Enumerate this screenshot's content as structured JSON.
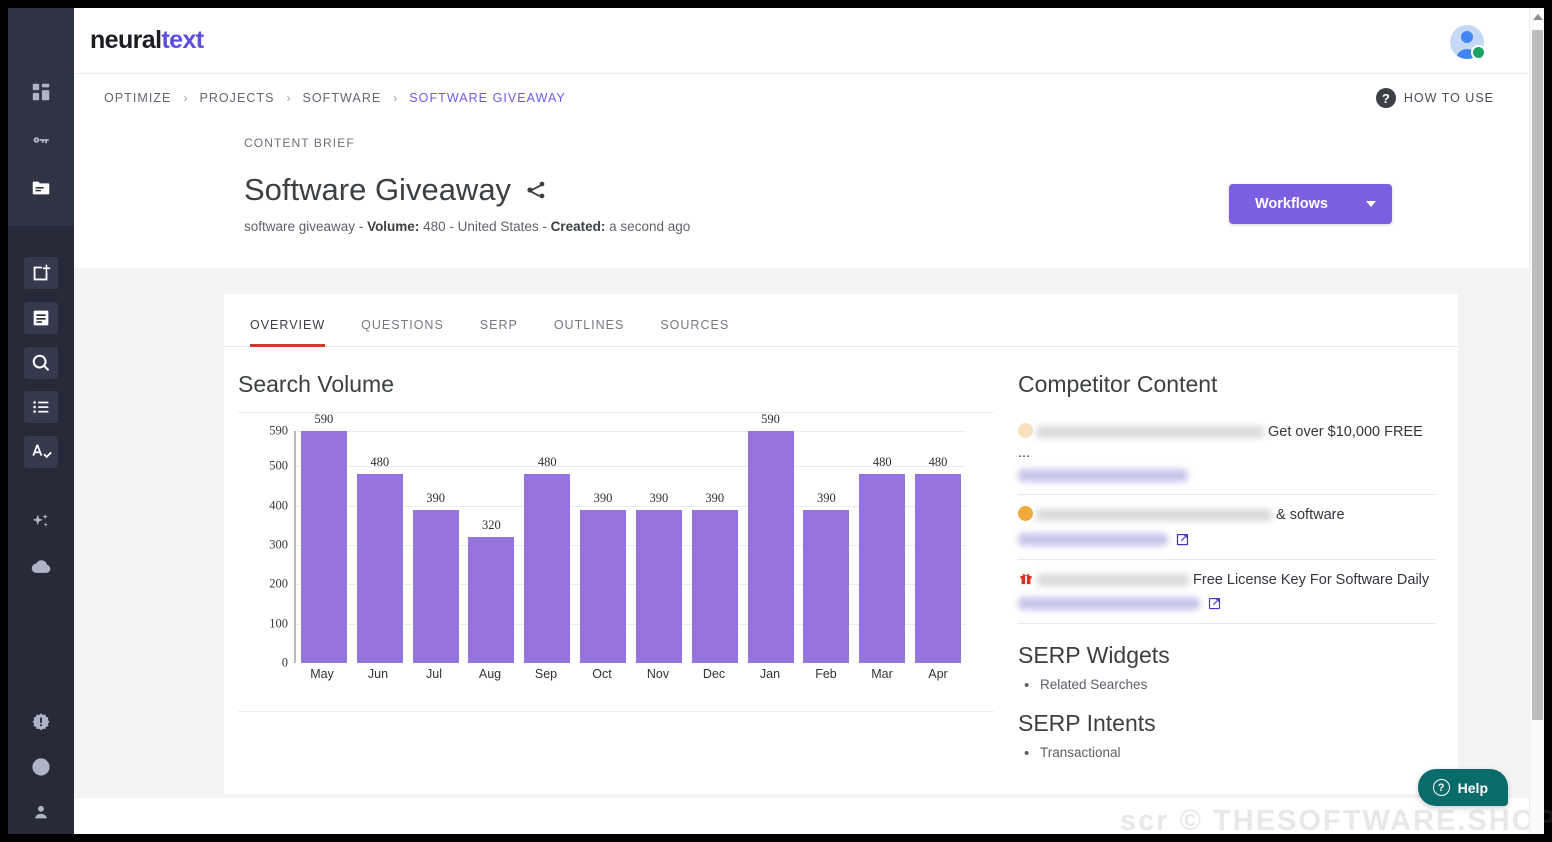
{
  "app": {
    "logo_part1": "neural",
    "logo_part2": "text"
  },
  "topbar": {
    "avatar_name": "user-avatar",
    "status": "online"
  },
  "breadcrumb": {
    "items": [
      {
        "label": "OPTIMIZE",
        "active": false
      },
      {
        "label": "PROJECTS",
        "active": false
      },
      {
        "label": "SOFTWARE",
        "active": false
      },
      {
        "label": "SOFTWARE GIVEAWAY",
        "active": true
      }
    ],
    "separator": "›"
  },
  "how_to_use": {
    "badge": "?",
    "label": "HOW TO USE"
  },
  "title_block": {
    "eyebrow": "CONTENT BRIEF",
    "title": "Software Giveaway",
    "keyword": "software giveaway",
    "sep1": " - ",
    "volume_label": "Volume:",
    "volume_value": " 480",
    "sep2": " - ",
    "country": "United States",
    "sep3": " - ",
    "created_label": "Created:",
    "created_value": " a second ago"
  },
  "workflows_button": {
    "label": "Workflows"
  },
  "tabs": [
    {
      "label": "OVERVIEW",
      "active": true
    },
    {
      "label": "QUESTIONS",
      "active": false
    },
    {
      "label": "SERP",
      "active": false
    },
    {
      "label": "OUTLINES",
      "active": false
    },
    {
      "label": "SOURCES",
      "active": false
    }
  ],
  "search_volume": {
    "heading": "Search Volume"
  },
  "chart_data": {
    "type": "bar",
    "title": "Search Volume",
    "xlabel": "",
    "ylabel": "",
    "categories": [
      "May",
      "Jun",
      "Jul",
      "Aug",
      "Sep",
      "Oct",
      "Nov",
      "Dec",
      "Jan",
      "Feb",
      "Mar",
      "Apr"
    ],
    "values": [
      590,
      480,
      390,
      320,
      480,
      390,
      390,
      390,
      590,
      390,
      480,
      480
    ],
    "yticks": [
      0,
      100,
      200,
      300,
      400,
      500,
      590
    ],
    "ylim": [
      0,
      590
    ],
    "grid": true,
    "legend": false,
    "bar_color": "#9575dd",
    "show_value_labels": true
  },
  "competitor": {
    "heading": "Competitor Content",
    "items": [
      {
        "icon": "circle-pale",
        "visible_text": "Get over $10,000 FREE ...",
        "has_external_link": false
      },
      {
        "icon": "circle-orange",
        "visible_text": "& software",
        "has_external_link": true
      },
      {
        "icon": "gift-red",
        "visible_text": "Free License Key For Software Daily",
        "has_external_link": true
      }
    ]
  },
  "serp_widgets": {
    "heading": "SERP Widgets",
    "items": [
      "Related Searches"
    ]
  },
  "serp_intents": {
    "heading": "SERP Intents",
    "items": [
      "Transactional"
    ]
  },
  "help_widget": {
    "label": "Help",
    "icon_glyph": "?"
  },
  "watermark": {
    "text": "scr © THESOFTWARE.SHOP"
  },
  "sidebar": {
    "top_items": [
      {
        "name": "dashboard-icon"
      },
      {
        "name": "key-icon"
      },
      {
        "name": "folder-icon"
      }
    ],
    "mid_items": [
      {
        "name": "new-document-icon"
      },
      {
        "name": "document-icon"
      },
      {
        "name": "search-icon"
      },
      {
        "name": "list-icon"
      },
      {
        "name": "spellcheck-icon"
      }
    ],
    "tool_items": [
      {
        "name": "sparkle-icon"
      },
      {
        "name": "cloud-icon"
      }
    ],
    "bottom_items": [
      {
        "name": "alert-icon"
      },
      {
        "name": "help-circle-icon"
      },
      {
        "name": "account-icon"
      }
    ]
  },
  "colors": {
    "brand_purple": "#5d4ee0",
    "button_purple": "#7b5fe0",
    "bar_purple": "#9575dd",
    "active_tab_red": "#d0392b",
    "help_teal": "#0a6b6b",
    "sidebar_dark": "#272b38"
  }
}
